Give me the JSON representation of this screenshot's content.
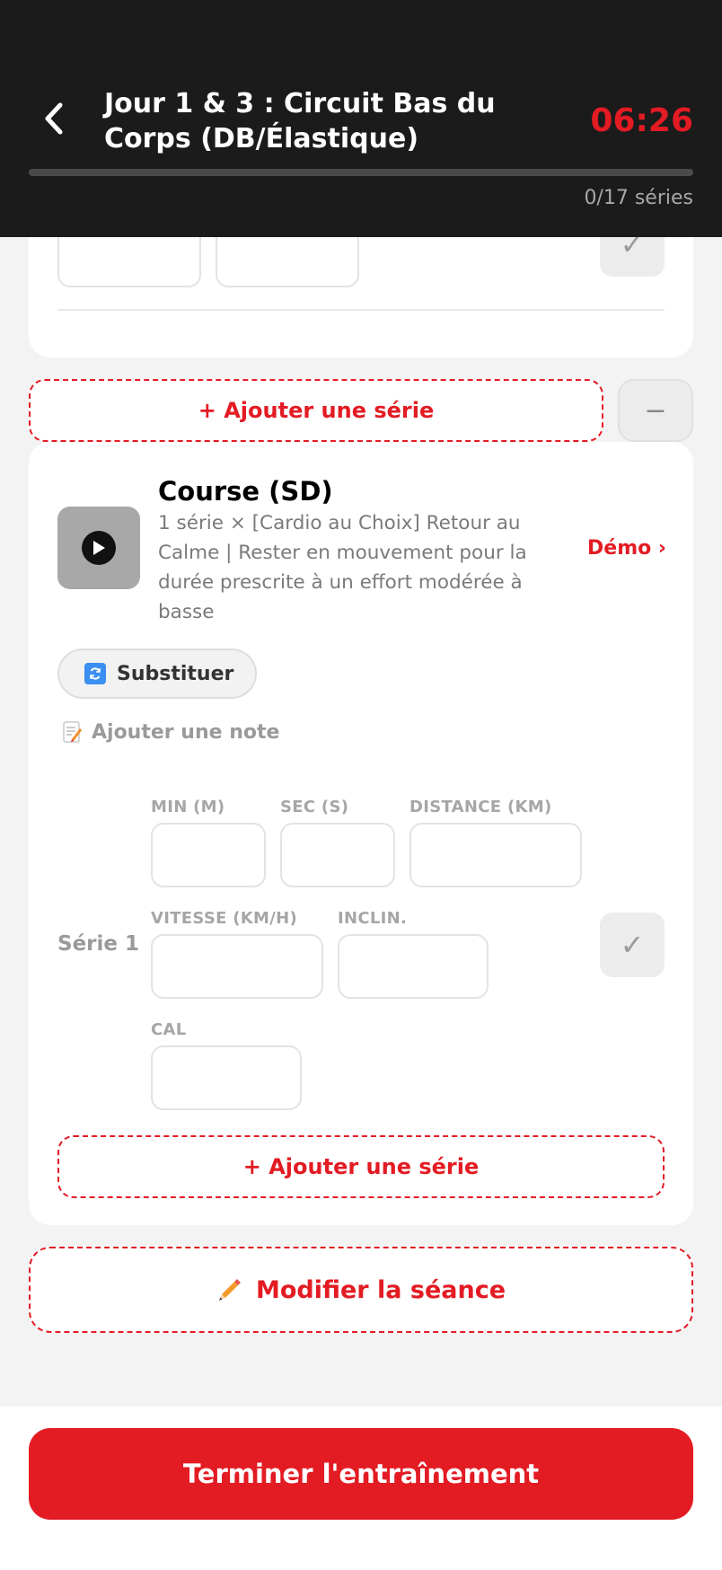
{
  "header": {
    "title": "Jour 1 & 3 : Circuit Bas du Corps (DB/Élastique)",
    "timer": "06:26",
    "progress_text": "0/17 séries",
    "progress_fraction": 0
  },
  "previous_block": {
    "add_series_label": "+ Ajouter une série",
    "remove_series_symbol": "−",
    "check_symbol": "✓"
  },
  "exercise": {
    "name": "Course (SD)",
    "description": "1 série × [Cardio au Choix] Retour au Calme | Rester en mouvement pour la durée prescrite à un effort modérée à basse",
    "demo_label": "Démo ›",
    "substitute_label": "Substituer",
    "note_label": "Ajouter une note",
    "series": [
      {
        "label": "Série 1",
        "fields": {
          "min": {
            "label": "MIN (M)",
            "value": ""
          },
          "sec": {
            "label": "SEC (S)",
            "value": ""
          },
          "distance": {
            "label": "DISTANCE (KM)",
            "value": ""
          },
          "speed": {
            "label": "VITESSE (KM/H)",
            "value": ""
          },
          "incline": {
            "label": "INCLIN.",
            "value": ""
          },
          "cal": {
            "label": "CAL",
            "value": ""
          }
        },
        "check_symbol": "✓"
      }
    ],
    "add_series_label": "+ Ajouter une série"
  },
  "modify_label": "Modifier la séance",
  "finish_label": "Terminer l'entraînement",
  "colors": {
    "accent": "#e31b23",
    "header_bg": "#1b1b1b",
    "page_bg": "#f3f3f3",
    "muted_text": "#9a9a9a"
  },
  "icons": [
    "back-chevron-icon",
    "play-icon",
    "refresh-icon",
    "memo-icon",
    "pencil-icon",
    "check-icon"
  ]
}
